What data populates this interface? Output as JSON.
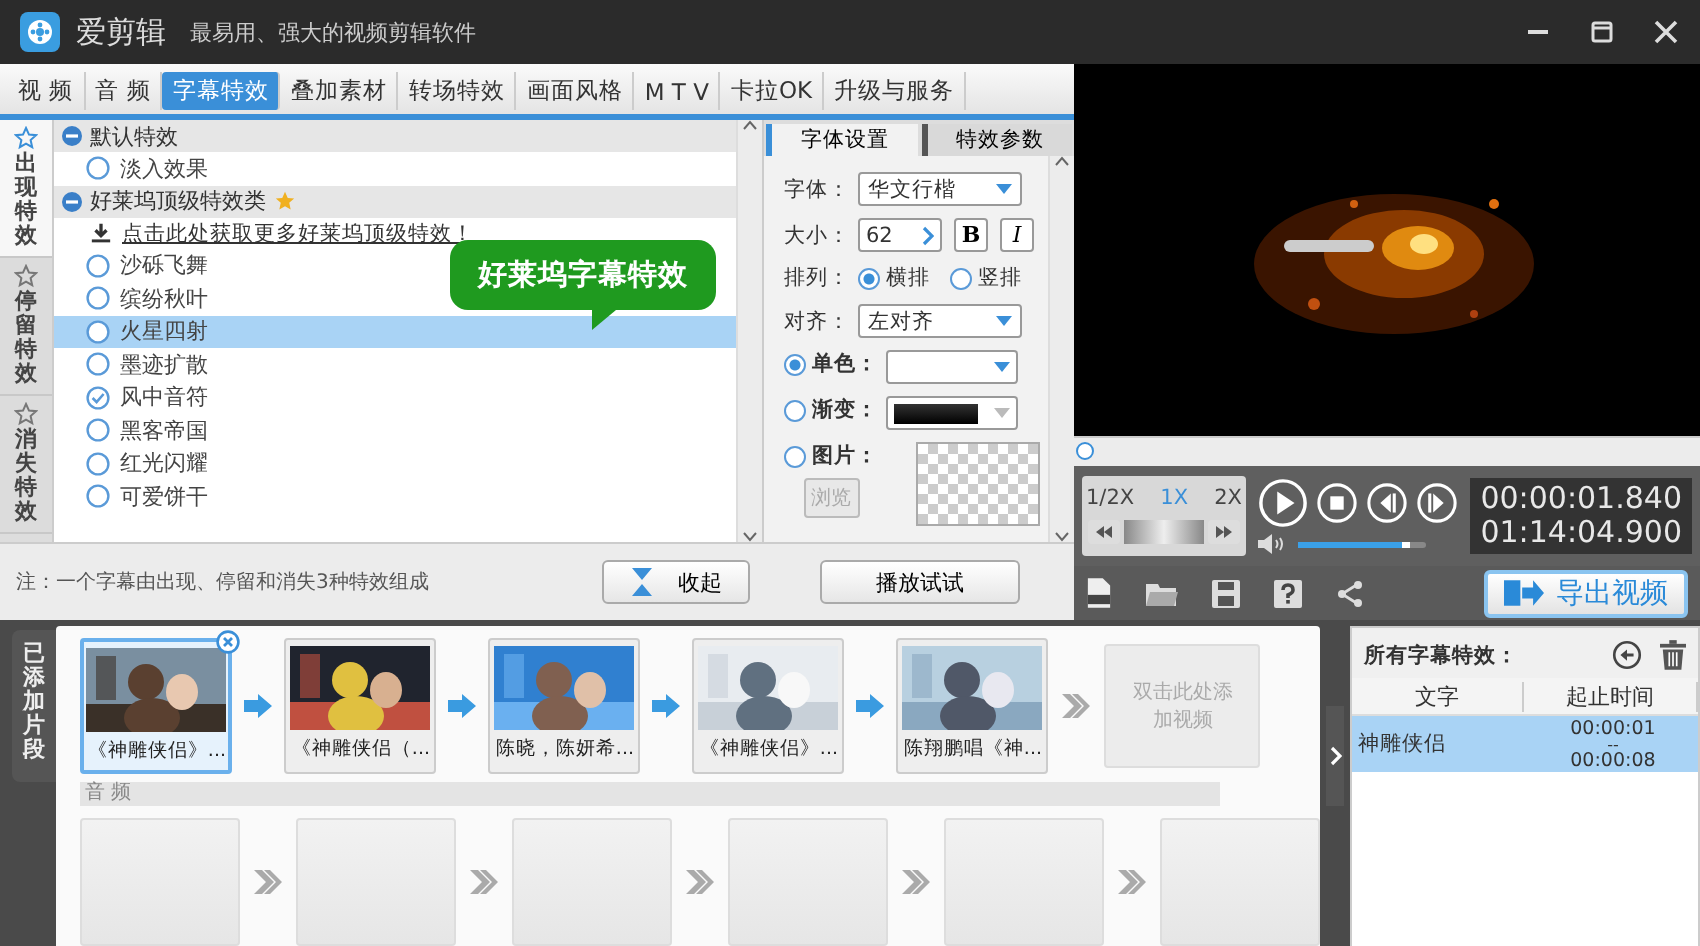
{
  "app": {
    "name": "爱剪辑",
    "slogan": "最易用、强大的视频剪辑软件"
  },
  "tabs": [
    {
      "label": "视 频",
      "selected": false
    },
    {
      "label": "音 频",
      "selected": false
    },
    {
      "label": "字幕特效",
      "selected": true
    },
    {
      "label": "叠加素材",
      "selected": false
    },
    {
      "label": "转场特效",
      "selected": false
    },
    {
      "label": "画面风格",
      "selected": false
    },
    {
      "label": "M T V",
      "selected": false
    },
    {
      "label": "卡拉OK",
      "selected": false
    },
    {
      "label": "升级与服务",
      "selected": false
    }
  ],
  "effect_types": [
    {
      "label": "出现特效",
      "selected": true
    },
    {
      "label": "停留特效",
      "selected": false
    },
    {
      "label": "消失特效",
      "selected": false
    }
  ],
  "effect_groups": [
    {
      "label": "默认特效",
      "expanded": true,
      "starred": false,
      "items": [
        {
          "label": "淡入效果",
          "selected": false,
          "checked": false
        }
      ]
    },
    {
      "label": "好莱坞顶级特效类",
      "expanded": true,
      "starred": true,
      "link": "点击此处获取更多好莱坞顶级特效！",
      "items": [
        {
          "label": "沙砾飞舞",
          "selected": false,
          "checked": false
        },
        {
          "label": "缤纷秋叶",
          "selected": false,
          "checked": false
        },
        {
          "label": "火星四射",
          "selected": true,
          "checked": false
        },
        {
          "label": "墨迹扩散",
          "selected": false,
          "checked": false
        },
        {
          "label": "风中音符",
          "selected": false,
          "checked": true
        },
        {
          "label": "黑客帝国",
          "selected": false,
          "checked": false
        },
        {
          "label": "红光闪耀",
          "selected": false,
          "checked": false
        },
        {
          "label": "可爱饼干",
          "selected": false,
          "checked": false
        }
      ]
    }
  ],
  "tooltip": "好莱坞字幕特效",
  "note": "注：一个字幕由出现、停留和消失3种特效组成",
  "collapse_button": "收起",
  "settings": {
    "tabs": [
      {
        "label": "字体设置",
        "selected": true
      },
      {
        "label": "特效参数",
        "selected": false
      }
    ],
    "font_label": "字体：",
    "font": "华文行楷",
    "size_label": "大小：",
    "size": "62",
    "bold_button": "B",
    "italic_button": "I",
    "layout_label": "排列：",
    "layout_options": [
      {
        "label": "横排",
        "selected": true
      },
      {
        "label": "竖排",
        "selected": false
      }
    ],
    "align_label": "对齐：",
    "align": "左对齐",
    "fill_options": [
      {
        "kind": "solid",
        "label": "单色：",
        "selected": true
      },
      {
        "kind": "gradient",
        "label": "渐变：",
        "selected": false
      },
      {
        "label": "图片：",
        "selected": false
      }
    ],
    "browse_button": {
      "label": "浏览",
      "disabled": true
    },
    "preview_button": "播放试试"
  },
  "player": {
    "progress": {
      "level": 0.01
    },
    "speeds": [
      {
        "label": "1/2X",
        "selected": false
      },
      {
        "label": "1X",
        "selected": true
      },
      {
        "label": "2X",
        "selected": false
      }
    ],
    "volume": {
      "level": 0.88
    },
    "current_time": "00:00:01.840",
    "total_time": "01:14:04.900",
    "export_button": "导出视频"
  },
  "timeline": {
    "label": "已添加片段",
    "clips": [
      {
        "caption": "《神雕侠侣》...",
        "selected": true
      },
      {
        "caption": "《神雕侠侣（...",
        "selected": false
      },
      {
        "caption": "陈晓，陈妍希...",
        "selected": false
      },
      {
        "caption": "《神雕侠侣》...",
        "selected": false
      },
      {
        "caption": "陈翔鹏唱《神...",
        "selected": false
      }
    ],
    "add_hint": "双击此处添加视频",
    "audio_label": "音 频"
  },
  "subtitles": {
    "title": "所有字幕特效：",
    "columns": [
      "文字",
      "起止时间"
    ],
    "rows": [
      {
        "text": "神雕侠侣",
        "start": "00:00:01",
        "separator": "--",
        "end": "00:00:08",
        "selected": true
      }
    ]
  }
}
